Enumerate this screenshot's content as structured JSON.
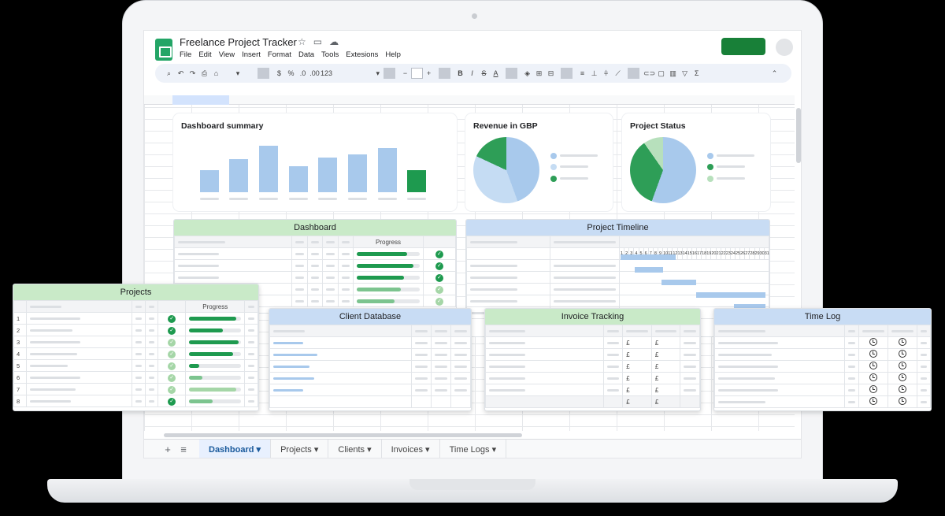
{
  "app": {
    "title": "Freelance Project Tracker",
    "menus": [
      "File",
      "Edit",
      "View",
      "Insert",
      "Format",
      "Data",
      "Tools",
      "Extesions",
      "Help"
    ],
    "toolbar": {
      "zoom_percent": "%",
      "decimal_dec": ".0",
      "decimal_inc": ".00",
      "number_format": "123",
      "currency": "$"
    }
  },
  "colors": {
    "accent_green": "#1e9a4f",
    "light_blue": "#a8c9ec",
    "header_green": "#c9eac8",
    "header_blue": "#c8dcf4"
  },
  "dashboard_summary": {
    "title": "Dashboard summary"
  },
  "revenue": {
    "title": "Revenue in GBP"
  },
  "project_status": {
    "title": "Project Status"
  },
  "dashboard_table": {
    "title": "Dashboard",
    "progress_header": "Progress",
    "progress": [
      0.8,
      0.9,
      0.75,
      0.7,
      0.6
    ]
  },
  "timeline": {
    "title": "Project Timeline",
    "days": [
      "1",
      "2",
      "3",
      "4",
      "5",
      "6",
      "7",
      "8",
      "9",
      "10",
      "11",
      "12",
      "13",
      "14",
      "15",
      "16",
      "17",
      "18",
      "19",
      "20",
      "21",
      "22",
      "23",
      "24",
      "25",
      "26",
      "27",
      "28",
      "29",
      "30",
      "31"
    ],
    "visible_days": [
      "1",
      "2",
      "3",
      "4",
      "5",
      "6",
      "7",
      "8",
      "9",
      "10",
      "11",
      "12",
      "13",
      "14",
      "15",
      "16",
      "17",
      "18",
      "19",
      "20",
      "21",
      "22",
      "23",
      "24",
      "25",
      "26",
      "27",
      "28",
      "29",
      "30",
      "31"
    ]
  },
  "projects": {
    "title": "Projects",
    "progress_header": "Progress",
    "rows": [
      "1",
      "2",
      "3",
      "4",
      "5",
      "6",
      "7",
      "8"
    ],
    "progress": [
      0.9,
      0.65,
      0.95,
      0.85,
      0.2,
      0.25,
      0.9,
      0.45
    ]
  },
  "client_db": {
    "title": "Client Database"
  },
  "invoice": {
    "title": "Invoice Tracking",
    "currency_symbol": "£"
  },
  "timelog": {
    "title": "Time Log"
  },
  "sheet_tabs": {
    "add": "+",
    "list": "≡",
    "tabs": [
      "Dashboard",
      "Projects",
      "Clients",
      "Invoices",
      "Time Logs"
    ],
    "arrow": "▾"
  }
}
